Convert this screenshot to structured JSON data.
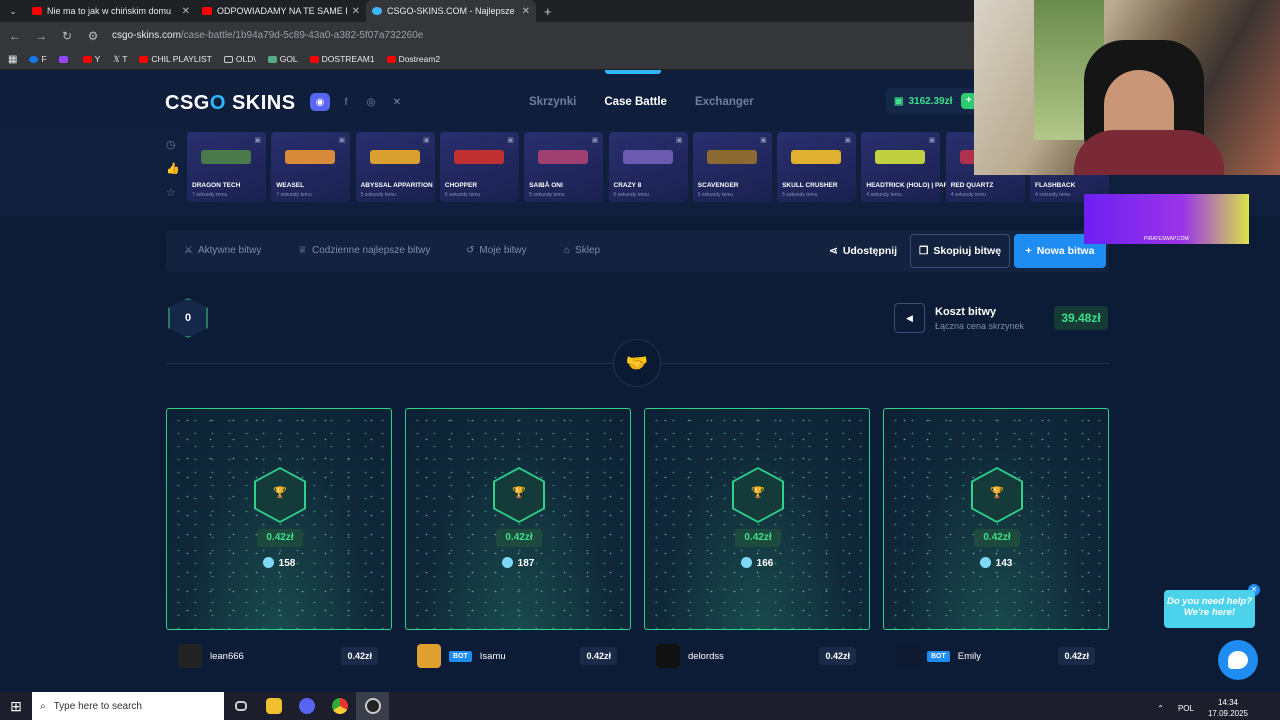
{
  "browser": {
    "tabs": [
      {
        "title": "Nie ma to jak w chińskim domu"
      },
      {
        "title": "ODPOWIADAMY NA TE SAME P"
      },
      {
        "title": "CSGO-SKINS.COM - Najlepsze"
      }
    ],
    "url_host": "csgo-skins.com",
    "url_path": "/case-battle/1b94a79d-5c89-43a0-a382-5f07a732260e",
    "bookmarks": [
      "F",
      "",
      "Y",
      "T",
      "CHIL PLAYLIST",
      "OLD\\",
      "GOL",
      "DOSTREAM1",
      "Dostream2"
    ]
  },
  "site": {
    "logo_left": "CSG",
    "logo_mid": "O",
    "logo_right": " SKINS",
    "nav": [
      "Skrzynki",
      "Case Battle",
      "Exchanger"
    ],
    "balance": "3162.39zł",
    "drops": [
      {
        "name": "DRAGON TECH",
        "time": "7 sekundy temu",
        "color": "#4a7a4a"
      },
      {
        "name": "WEASEL",
        "time": "7 sekundy temu",
        "color": "#d98a3a"
      },
      {
        "name": "ABYSSAL APPARITION",
        "time": "5 sekundy temu",
        "color": "#d9a030"
      },
      {
        "name": "CHOPPER",
        "time": "5 sekundy temu",
        "color": "#c03030"
      },
      {
        "name": "SAIBĀ ONI",
        "time": "5 sekundy temu",
        "color": "#a04070"
      },
      {
        "name": "CRAZY 8",
        "time": "5 sekundy temu",
        "color": "#6a5ab0"
      },
      {
        "name": "SCAVENGER",
        "time": "5 sekundy temu",
        "color": "#8a6a30"
      },
      {
        "name": "SKULL CRUSHER",
        "time": "5 sekundy temu",
        "color": "#e0b030"
      },
      {
        "name": "HEADTRICK (HOLO) | PARIS 2025",
        "time": "4 sekundy temu",
        "color": "#c0d040"
      },
      {
        "name": "RED QUARTZ",
        "time": "4 sekundy temu",
        "color": "#b03050"
      },
      {
        "name": "FLASHBACK",
        "time": "4 sekundy temu",
        "color": "#5a5a8a"
      }
    ],
    "menu": [
      "Aktywne bitwy",
      "Codzienne najlepsze bitwy",
      "Moje bitwy",
      "Sklep"
    ],
    "share": "Udostępnij",
    "copy": "Skopiuj bitwę",
    "new": "Nowa bitwa",
    "round": "0",
    "cost_title": "Koszt bitwy",
    "cost_sub": "Łączna cena skrzynek",
    "cost_value": "39.48zł",
    "players": [
      {
        "name": "lean666",
        "bot": "",
        "value": "0.42zł",
        "count": "158",
        "total": "0.42zł",
        "avatar": "#222"
      },
      {
        "name": "Isamu",
        "bot": "BOT",
        "value": "0.42zł",
        "count": "187",
        "total": "0.42zł",
        "avatar": "#e0a030"
      },
      {
        "name": "delordss",
        "bot": "",
        "value": "0.42zł",
        "count": "166",
        "total": "0.42zł",
        "avatar": "#111"
      },
      {
        "name": "Emily",
        "bot": "BOT",
        "value": "0.42zł",
        "count": "143",
        "total": "0.42zł",
        "avatar": "#0e1a30"
      }
    ],
    "help_line1": "Do you need help?",
    "help_line2": "We're here!",
    "ad_text": "PIRATESWAP.COM"
  },
  "taskbar": {
    "search": "Type here to search",
    "lang": "POL",
    "time": "14:34",
    "date": "17.09.2025"
  }
}
